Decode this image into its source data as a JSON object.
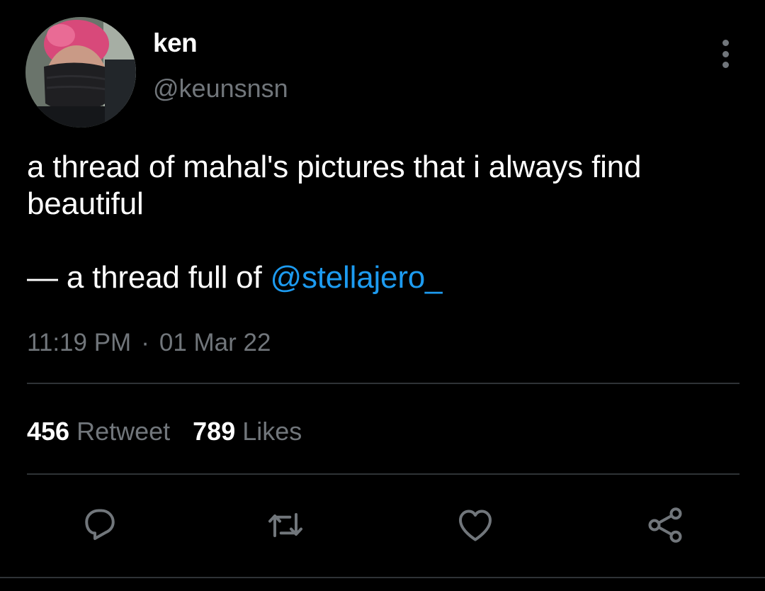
{
  "author": {
    "display_name": "ken",
    "handle": "@keunsnsn"
  },
  "tweet": {
    "text_line1": "a thread of mahal's pictures that i always find beautiful",
    "text_line2_prefix": "— a thread full of ",
    "mention": "@stellajero_"
  },
  "meta": {
    "time": "11:19 PM",
    "separator": "·",
    "date": "01 Mar 22"
  },
  "stats": {
    "retweets_count": "456",
    "retweets_label": "Retweet",
    "likes_count": "789",
    "likes_label": "Likes"
  },
  "actions": {
    "icons": [
      "reply-icon",
      "retweet-icon",
      "like-icon",
      "share-icon"
    ],
    "icon_color": "#71767b"
  },
  "colors": {
    "background": "#000000",
    "text": "#ffffff",
    "secondary_text": "#71767b",
    "link": "#1d9bf0",
    "divider": "#2f3336"
  }
}
